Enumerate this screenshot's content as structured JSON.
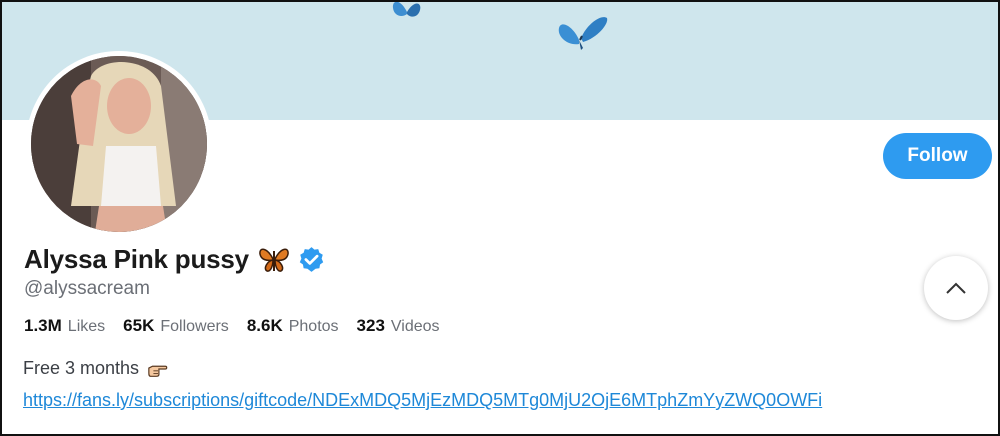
{
  "profile": {
    "display_name": "Alyssa Pink pussy",
    "name_emoji_icon": "butterfly-emoji-icon",
    "verified_icon": "verified-badge-icon",
    "handle": "@alyssacream",
    "follow_label": "Follow"
  },
  "stats": [
    {
      "value": "1.3M",
      "label": "Likes"
    },
    {
      "value": "65K",
      "label": "Followers"
    },
    {
      "value": "8.6K",
      "label": "Photos"
    },
    {
      "value": "323",
      "label": "Videos"
    }
  ],
  "bio": {
    "line1": "Free 3 months",
    "line1_icon": "pointing-hand-icon",
    "link": "https://fans.ly/subscriptions/giftcode/NDExMDQ5MjEzMDQ5MTg0MjU2OjE6MTphZmYyZWQ0OWFi"
  },
  "colors": {
    "banner": "#cfe6ed",
    "follow_button": "#2e9bf0",
    "link": "#1e88d8",
    "verified": "#2e9bf0"
  }
}
